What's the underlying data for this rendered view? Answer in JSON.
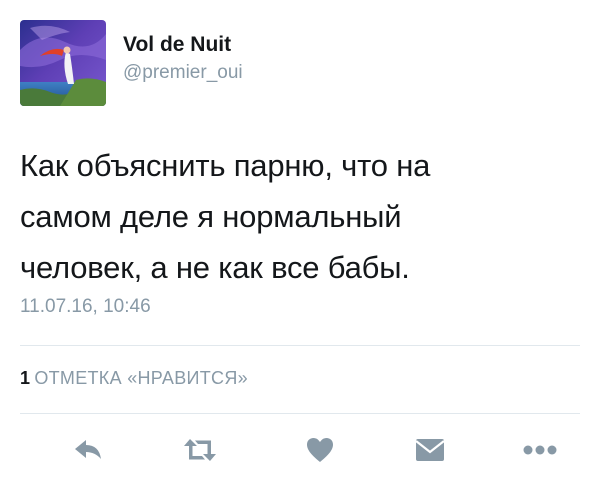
{
  "tweet": {
    "display_name": "Vol de Nuit",
    "handle": "@premier_oui",
    "text": "Как объяснить парню, что на\nсамом деле я нормальный\nчеловек, а не как все бабы.",
    "timestamp": "11.07.16, 10:46"
  },
  "engagement": {
    "like_count": "1",
    "like_label": "ОТМЕТКА «НРАВИТСЯ»"
  },
  "actions": [
    {
      "icon": "reply-icon"
    },
    {
      "icon": "retweet-icon"
    },
    {
      "icon": "heart-icon"
    },
    {
      "icon": "direct-message-icon"
    },
    {
      "icon": "more-icon"
    }
  ],
  "colors": {
    "text": "#14171a",
    "secondary": "#8899a6",
    "divider": "#e1e8ed",
    "icon": "#8899a6"
  }
}
